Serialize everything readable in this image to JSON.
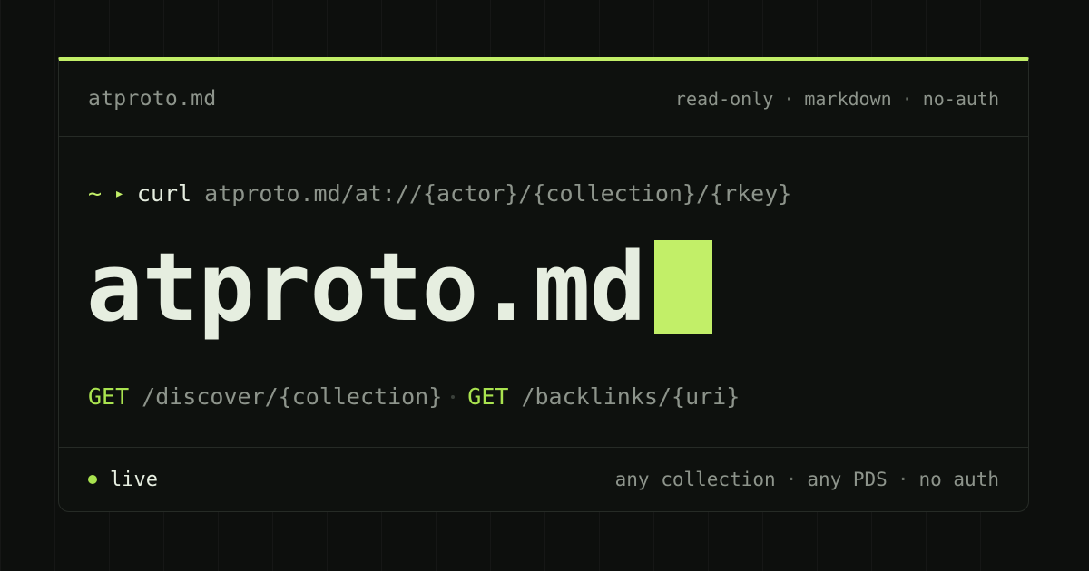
{
  "header": {
    "brand": "atproto.md",
    "tags": [
      "read-only",
      "markdown",
      "no-auth"
    ],
    "separator": "·"
  },
  "prompt": {
    "tilde": "~",
    "arrow": "▸",
    "command": "curl",
    "argument": "atproto.md/at://{actor}/{collection}/{rkey}"
  },
  "hero": {
    "title": "atproto.md"
  },
  "routes": [
    {
      "method": "GET",
      "path": "/discover/{collection}"
    },
    {
      "method": "GET",
      "path": "/backlinks/{uri}"
    }
  ],
  "footer": {
    "status_label": "live",
    "tags": [
      "any collection",
      "any PDS",
      "no auth"
    ],
    "separator": "·"
  },
  "colors": {
    "background": "#0d0f0d",
    "card": "#0e110e",
    "accent": "#c2ef68",
    "method": "#a9e34f",
    "text_primary": "#e6eee0",
    "text_muted": "#8d948b"
  }
}
